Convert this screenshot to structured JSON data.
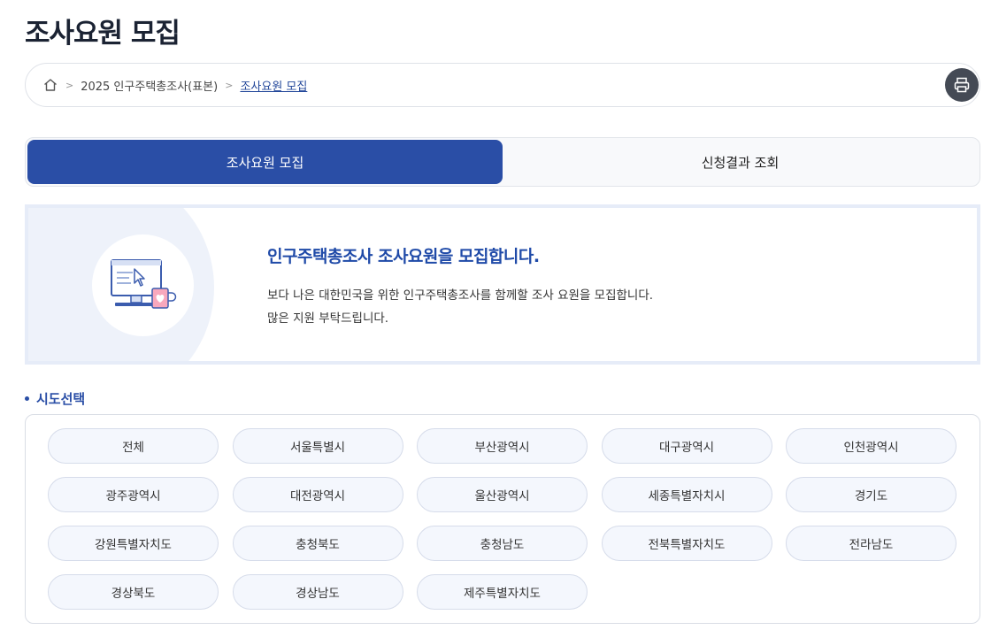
{
  "page": {
    "title": "조사요원 모집"
  },
  "breadcrumb": {
    "items": [
      "2025 인구주택총조사(표본)"
    ],
    "current": "조사요원 모집"
  },
  "tabs": [
    {
      "label": "조사요원 모집",
      "active": true
    },
    {
      "label": "신청결과 조회",
      "active": false
    }
  ],
  "banner": {
    "headline": "인구주택총조사 조사요원을 모집합니다.",
    "line1": "보다 나은 대한민국을 위한 인구주택총조사를 함께할 조사 요원을 모집합니다.",
    "line2": "많은 지원 부탁드립니다."
  },
  "regions": {
    "title": "시도선택",
    "items": [
      "전체",
      "서울특별시",
      "부산광역시",
      "대구광역시",
      "인천광역시",
      "광주광역시",
      "대전광역시",
      "울산광역시",
      "세종특별자치시",
      "경기도",
      "강원특별자치도",
      "충청북도",
      "충청남도",
      "전북특별자치도",
      "전라남도",
      "경상북도",
      "경상남도",
      "제주특별자치도"
    ]
  },
  "colors": {
    "primary": "#2a4ea6",
    "title": "#1b2333",
    "banner_border": "#e6ecf8"
  },
  "icons": [
    "home-icon",
    "print-icon",
    "monitor-mug-illustration"
  ]
}
